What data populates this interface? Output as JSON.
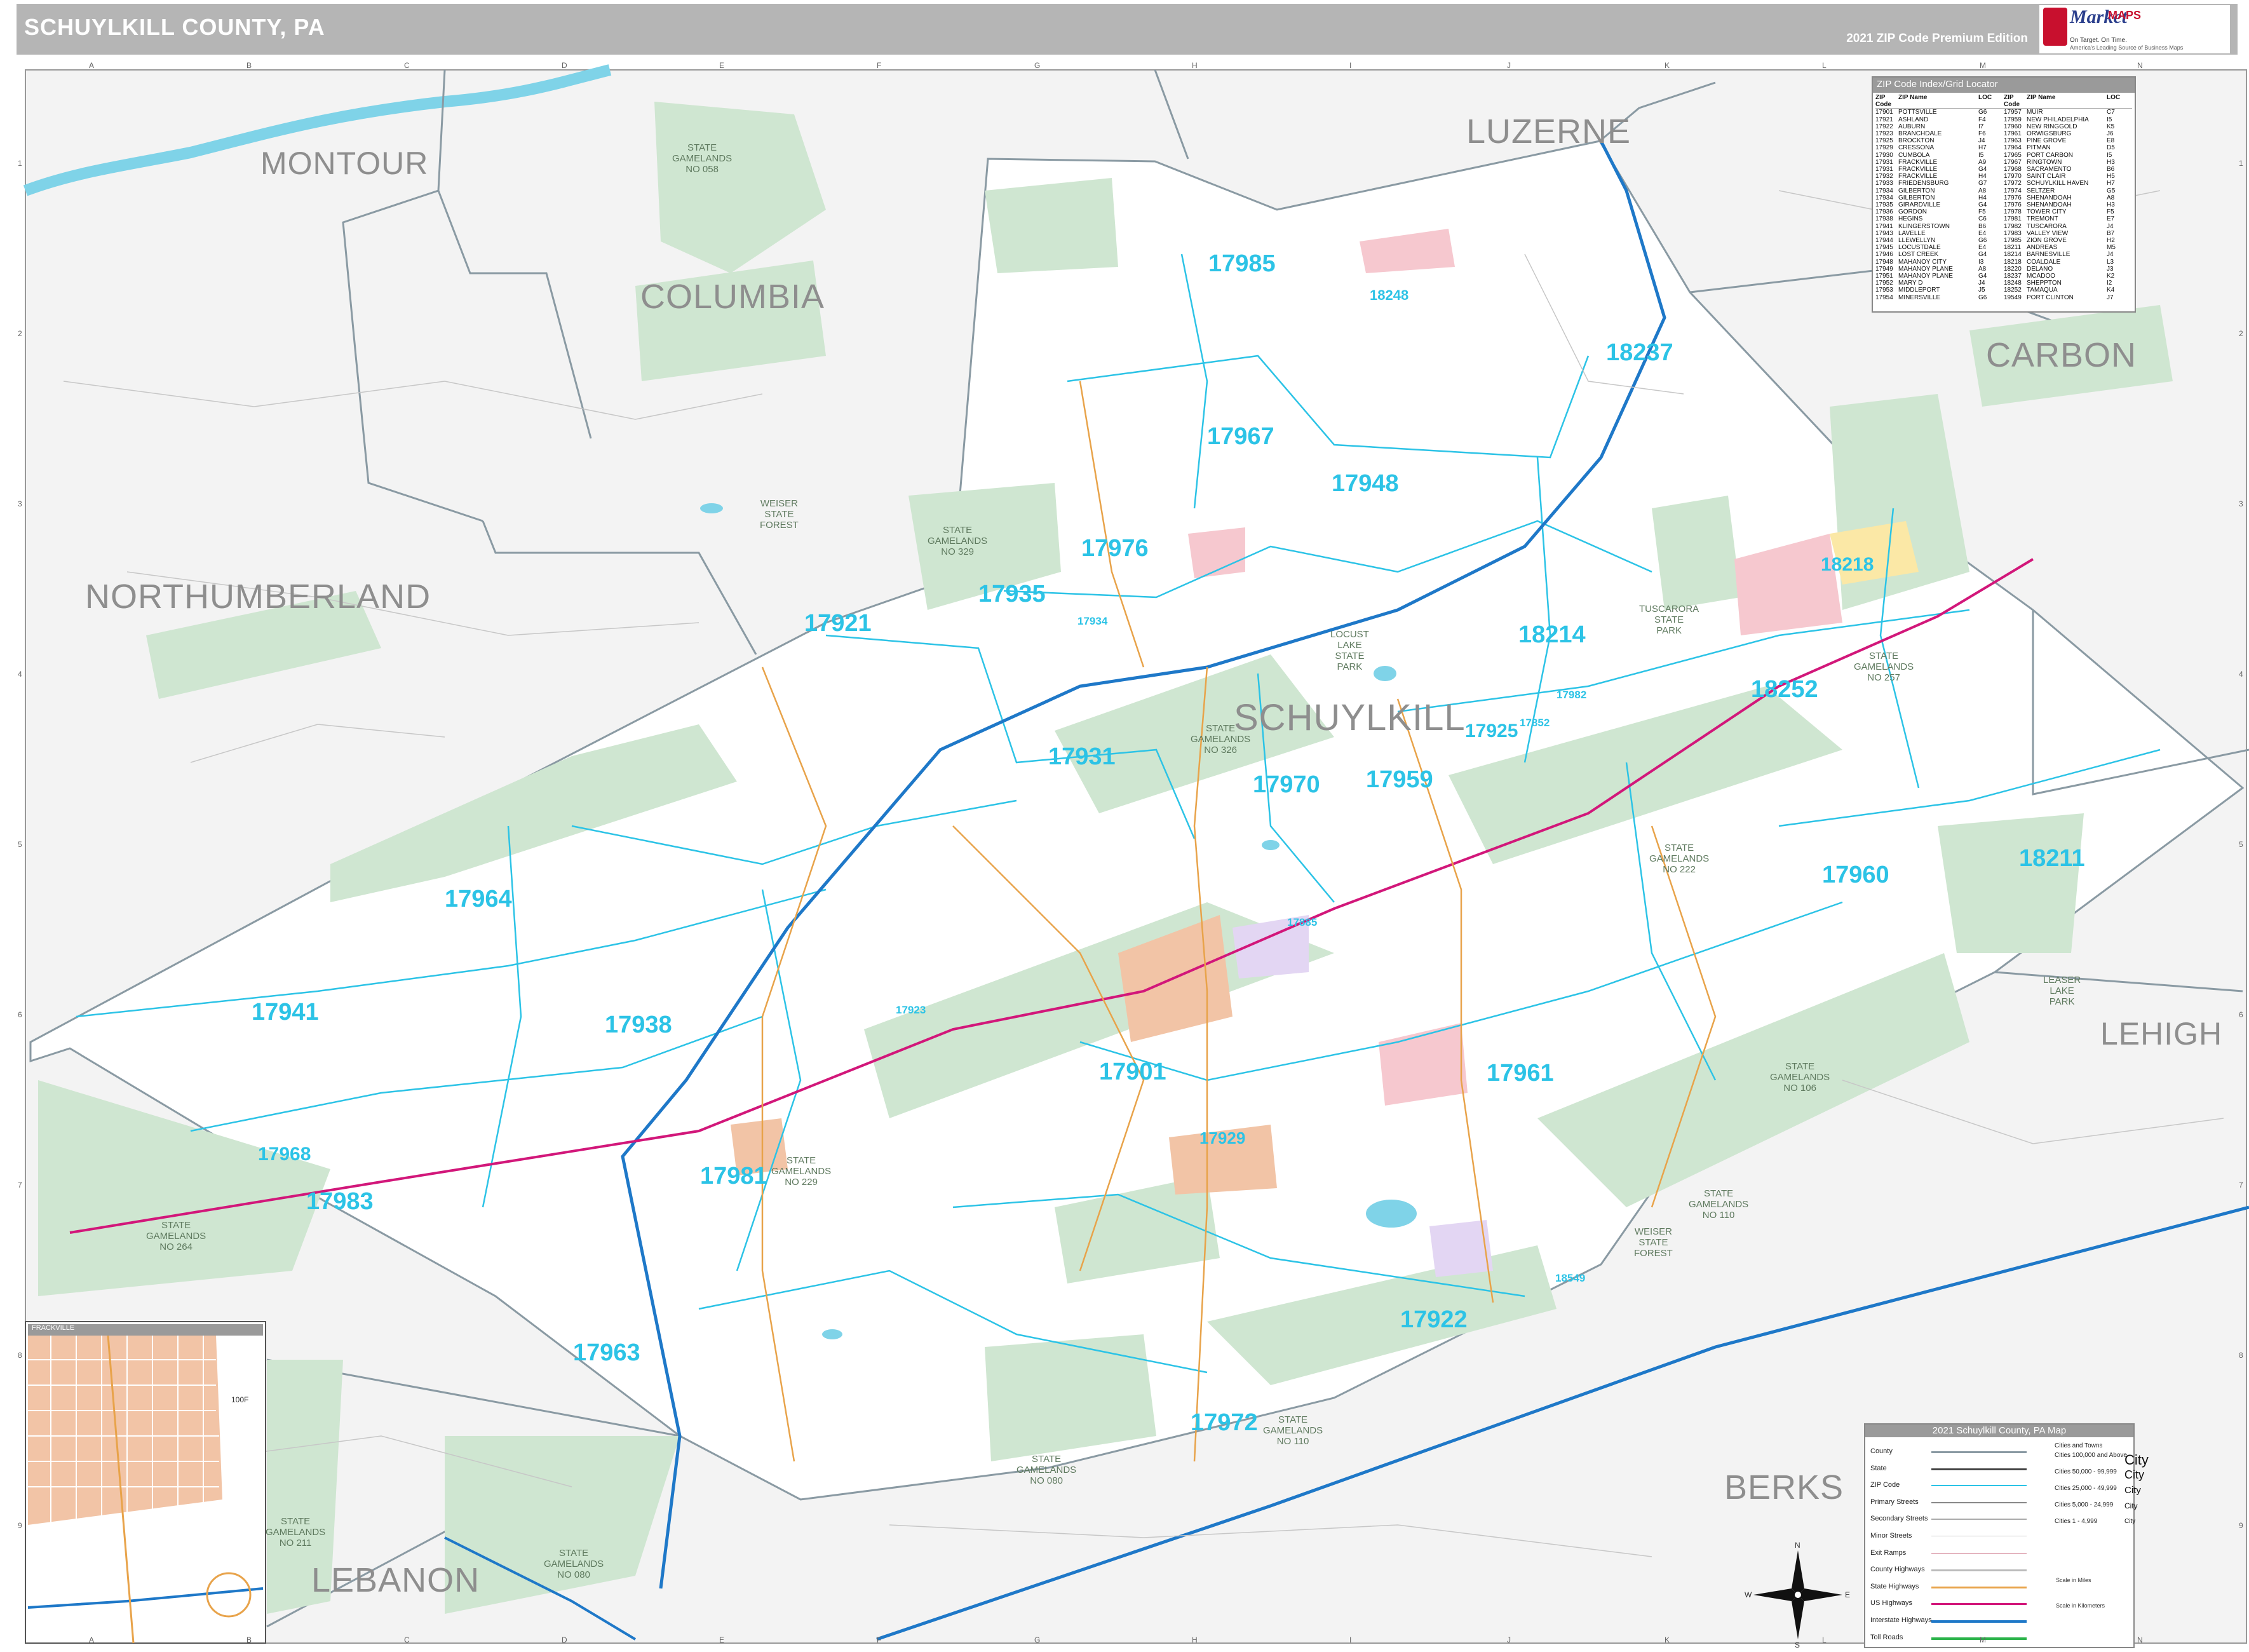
{
  "header": {
    "title": "SCHUYLKILL COUNTY, PA",
    "edition": "2021 ZIP Code Premium Edition",
    "logo": {
      "brand_market": "Market",
      "brand_maps": "MAPS",
      "tagline": "On Target. On Time.",
      "tagline2": "America's Leading Source of Business Maps"
    }
  },
  "grid": {
    "columns": [
      "A",
      "B",
      "C",
      "D",
      "E",
      "F",
      "G",
      "H",
      "I",
      "J",
      "K",
      "L",
      "M",
      "N"
    ],
    "rows": [
      "1",
      "2",
      "3",
      "4",
      "5",
      "6",
      "7",
      "8",
      "9"
    ]
  },
  "counties": {
    "neighbors": [
      "MONTOUR",
      "COLUMBIA",
      "LUZERNE",
      "CARBON",
      "NORTHUMBERLAND",
      "LEHIGH",
      "BERKS",
      "LEBANON"
    ],
    "main": "SCHUYLKILL"
  },
  "zip_labels_large": [
    "17985",
    "18248",
    "18237",
    "17967",
    "17948",
    "17976",
    "17935",
    "17921",
    "18214",
    "18218",
    "18252",
    "17931",
    "17925",
    "17970",
    "17959",
    "17960",
    "18211",
    "17964",
    "17941",
    "17938",
    "17901",
    "17961",
    "17968",
    "17983",
    "17981",
    "17929",
    "17922",
    "17963",
    "17972"
  ],
  "zip_labels_small": [
    "17934",
    "17982",
    "17852",
    "17885",
    "17923",
    "18549"
  ],
  "gamelands": [
    "STATE\nGAMELANDS\nNO 058",
    "STATE\nGAMELANDS\nNO 329",
    "WEISER\nSTATE\nFOREST",
    "STATE\nGAMELANDS\nNO 326",
    "LOCUST\nLAKE\nSTATE\nPARK",
    "TUSCARORA\nSTATE\nPARK",
    "STATE\nGAMELANDS\nNO 222",
    "STATE\nGAMELANDS\nNO 257",
    "STATE\nGAMELANDS\nNO 106",
    "STATE\nGAMELANDS\nNO 110",
    "WEISER\nSTATE\nFOREST",
    "STATE\nGAMELANDS\nNO 229",
    "STATE\nGAMELANDS\nNO 264",
    "STATE\nGAMELANDS\nNO 211",
    "STATE\nGAMELANDS\nNO 080",
    "STATE\nGAMELANDS\nNO 110",
    "LEASER\nLAKE\nPARK",
    "STATE\nGAMELANDS\nNO 080"
  ],
  "zip_index": {
    "title": "ZIP Code Index/Grid Locator",
    "headers": [
      "ZIP Code",
      "ZIP Name",
      "LOC"
    ],
    "left": [
      [
        "17901",
        "POTTSVILLE",
        "G6"
      ],
      [
        "17921",
        "ASHLAND",
        "F4"
      ],
      [
        "17922",
        "AUBURN",
        "I7"
      ],
      [
        "17923",
        "BRANCHDALE",
        "F6"
      ],
      [
        "17925",
        "BROCKTON",
        "J4"
      ],
      [
        "17929",
        "CRESSONA",
        "H7"
      ],
      [
        "17930",
        "CUMBOLA",
        "I5"
      ],
      [
        "17931",
        "FRACKVILLE",
        "A9"
      ],
      [
        "17931",
        "FRACKVILLE",
        "G4"
      ],
      [
        "17932",
        "FRACKVILLE",
        "H4"
      ],
      [
        "17933",
        "FRIEDENSBURG",
        "G7"
      ],
      [
        "17934",
        "GILBERTON",
        "A8"
      ],
      [
        "17934",
        "GILBERTON",
        "H4"
      ],
      [
        "17935",
        "GIRARDVILLE",
        "G4"
      ],
      [
        "17936",
        "GORDON",
        "F5"
      ],
      [
        "17938",
        "HEGINS",
        "C6"
      ],
      [
        "17941",
        "KLINGERSTOWN",
        "B6"
      ],
      [
        "17943",
        "LAVELLE",
        "E4"
      ],
      [
        "17944",
        "LLEWELLYN",
        "G6"
      ],
      [
        "17945",
        "LOCUSTDALE",
        "E4"
      ],
      [
        "17946",
        "LOST CREEK",
        "G4"
      ],
      [
        "17948",
        "MAHANOY CITY",
        "I3"
      ],
      [
        "17949",
        "MAHANOY PLANE",
        "A8"
      ],
      [
        "17951",
        "MAHANOY PLANE",
        "G4"
      ],
      [
        "17952",
        "MARY D",
        "J4"
      ],
      [
        "17953",
        "MIDDLEPORT",
        "J5"
      ],
      [
        "17954",
        "MINERSVILLE",
        "G6"
      ]
    ],
    "right": [
      [
        "17957",
        "MUIR",
        "C7"
      ],
      [
        "17959",
        "NEW PHILADELPHIA",
        "I5"
      ],
      [
        "17960",
        "NEW RINGGOLD",
        "K5"
      ],
      [
        "17961",
        "ORWIGSBURG",
        "J6"
      ],
      [
        "17963",
        "PINE GROVE",
        "E8"
      ],
      [
        "17964",
        "PITMAN",
        "D5"
      ],
      [
        "17965",
        "PORT CARBON",
        "I5"
      ],
      [
        "17967",
        "RINGTOWN",
        "H3"
      ],
      [
        "17968",
        "SACRAMENTO",
        "B6"
      ],
      [
        "17970",
        "SAINT CLAIR",
        "H5"
      ],
      [
        "17972",
        "SCHUYLKILL HAVEN",
        "H7"
      ],
      [
        "17974",
        "SELTZER",
        "G5"
      ],
      [
        "17976",
        "SHENANDOAH",
        "A8"
      ],
      [
        "17976",
        "SHENANDOAH",
        "H3"
      ],
      [
        "17978",
        "TOWER CITY",
        "F5"
      ],
      [
        "17981",
        "TREMONT",
        "E7"
      ],
      [
        "17982",
        "TUSCARORA",
        "J4"
      ],
      [
        "17983",
        "VALLEY VIEW",
        "B7"
      ],
      [
        "17985",
        "ZION GROVE",
        "H2"
      ],
      [
        "18211",
        "ANDREAS",
        "M5"
      ],
      [
        "18214",
        "BARNESVILLE",
        "J4"
      ],
      [
        "18218",
        "COALDALE",
        "L3"
      ],
      [
        "18220",
        "DELANO",
        "J3"
      ],
      [
        "18237",
        "MCADOO",
        "K2"
      ],
      [
        "18248",
        "SHEPPTON",
        "I2"
      ],
      [
        "18252",
        "TAMAQUA",
        "K4"
      ],
      [
        "19549",
        "PORT CLINTON",
        "J7"
      ]
    ]
  },
  "legend": {
    "title": "2021 Schuylkill County, PA Map",
    "items": [
      "County",
      "State",
      "ZIP Code",
      "Primary Streets",
      "Secondary Streets",
      "Minor Streets",
      "Exit Ramps",
      "County Highways",
      "State Highways",
      "US Highways",
      "Interstate Highways",
      "Toll Roads"
    ],
    "cities_header": "Cities and Towns",
    "city_sizes": [
      "Cities 100,000 and Above",
      "Cities 50,000 - 99,999",
      "Cities 25,000 - 49,999",
      "Cities 5,000 - 24,999",
      "Cities 1 - 4,999"
    ],
    "city_samples": [
      "City",
      "City",
      "City",
      "City",
      "City"
    ],
    "scale_miles": "Scale in Miles",
    "scale_km": "Scale in Kilometers"
  },
  "inset": {
    "title": "FRACKVILLE",
    "label_100f": "100F"
  },
  "compass": {
    "n": "N",
    "s": "S",
    "e": "E",
    "w": "W"
  },
  "colors": {
    "gamelands": "#cfe6d1",
    "neighbor_fill": "#f1f1f1",
    "county_border": "#8a9aa3",
    "zip_border": "#2cc3e6",
    "interstate": "#1e78c8",
    "us_highway": "#d2177a",
    "state_highway": "#e8a34a",
    "water": "#7fd3e8",
    "urban": "#f2c4a6"
  }
}
